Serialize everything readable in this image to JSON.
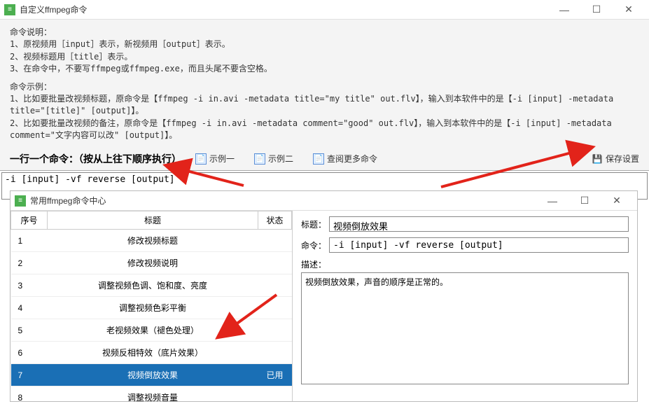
{
  "main_window": {
    "title": "自定义ffmpeg命令"
  },
  "help": {
    "heading1": "命令说明：",
    "line1": "1、原视频用［input］表示，新视频用［output］表示。",
    "line2": "2、视频标题用［title］表示。",
    "line3": "3、在命令中，不要写ffmpeg或ffmpeg.exe，而且头尾不要含空格。",
    "heading2": "命令示例：",
    "example1": "1、比如要批量改视频标题，原命令是【ffmpeg -i in.avi -metadata title=\"my title\" out.flv】，输入到本软件中的是【-i [input] -metadata title=\"[title]\" [output]】。",
    "example2": "2、比如要批量改视频的备注，原命令是【ffmpeg -i in.avi -metadata comment=\"good\" out.flv】，输入到本软件中的是【-i [input] -metadata comment=\"文字内容可以改\" [output]】。"
  },
  "toolbar": {
    "label": "一行一个命令：（按从上往下顺序执行）",
    "example1": "示例一",
    "example2": "示例二",
    "more": "查阅更多命令",
    "save": "保存设置"
  },
  "command_text": "-i [input] -vf reverse [output]",
  "inner_window": {
    "title": "常用ffmpeg命令中心"
  },
  "table": {
    "headers": {
      "col1": "序号",
      "col2": "标题",
      "col3": "状态"
    },
    "rows": [
      {
        "id": "1",
        "title": "修改视频标题",
        "status": ""
      },
      {
        "id": "2",
        "title": "修改视频说明",
        "status": ""
      },
      {
        "id": "3",
        "title": "调整视频色调、饱和度、亮度",
        "status": ""
      },
      {
        "id": "4",
        "title": "调整视频色彩平衡",
        "status": ""
      },
      {
        "id": "5",
        "title": "老视频效果（褪色处理）",
        "status": ""
      },
      {
        "id": "6",
        "title": "视频反相特效（底片效果）",
        "status": ""
      },
      {
        "id": "7",
        "title": "视频倒放效果",
        "status": "已用",
        "selected": true
      },
      {
        "id": "8",
        "title": "调整视频音量",
        "status": ""
      }
    ]
  },
  "detail": {
    "title_label": "标题：",
    "title_value": "视频倒放效果",
    "cmd_label": "命令：",
    "cmd_value": "-i [input] -vf reverse [output]",
    "desc_label": "描述：",
    "desc_value": "视频倒放效果，声音的顺序是正常的。"
  }
}
